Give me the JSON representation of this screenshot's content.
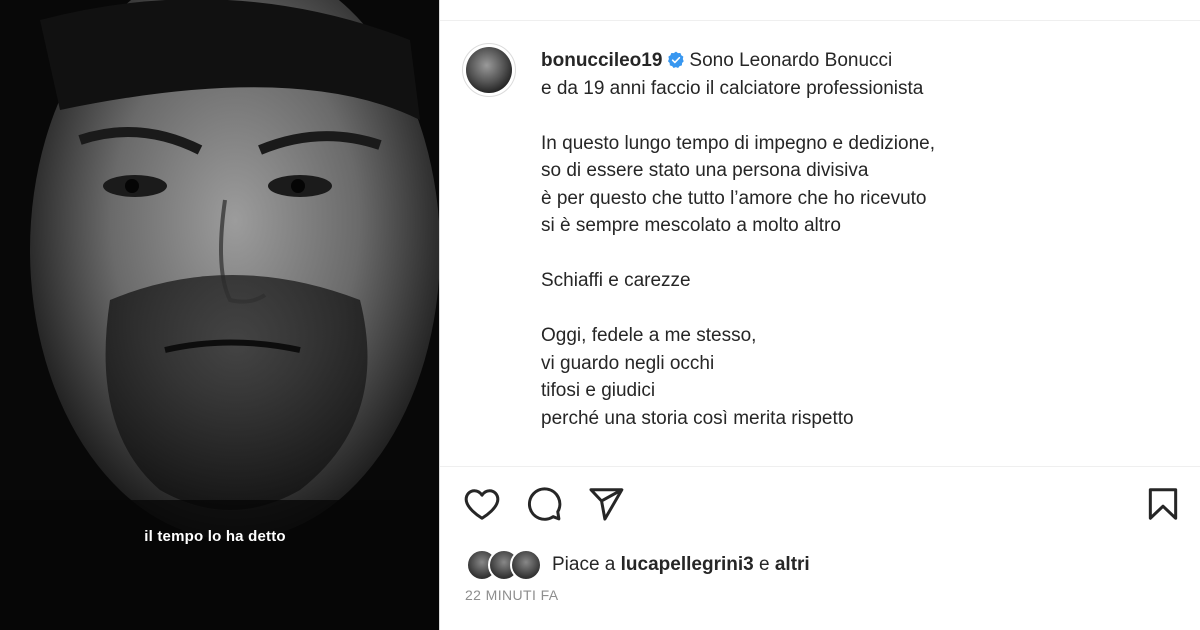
{
  "media": {
    "caption_overlay": "il tempo lo ha detto"
  },
  "post": {
    "username": "bonuccileo19",
    "caption_first_line": "Sono Leonardo Bonucci",
    "caption_lines": [
      "e da 19 anni faccio il calciatore professionista"
    ],
    "paragraphs": [
      [
        "In questo lungo tempo di impegno e dedizione,",
        "so di essere stato una persona divisiva",
        "è per questo che tutto l’amore che ho ricevuto",
        "si è sempre mescolato a molto altro"
      ],
      [
        "Schiaffi e carezze"
      ],
      [
        "Oggi, fedele a me stesso,",
        "vi guardo negli occhi",
        "tifosi e giudici",
        "perché una storia così merita rispetto"
      ]
    ]
  },
  "actions": {
    "icons": [
      "heart-icon",
      "comment-icon",
      "share-icon",
      "bookmark-icon"
    ]
  },
  "likes": {
    "prefix": "Piace a",
    "user": "lucapellegrini3",
    "connector": "e",
    "others": "altri"
  },
  "timestamp": "22 MINUTI FA",
  "colors": {
    "verified": "#3897f0",
    "text": "#262626",
    "muted": "#8e8e8e"
  }
}
